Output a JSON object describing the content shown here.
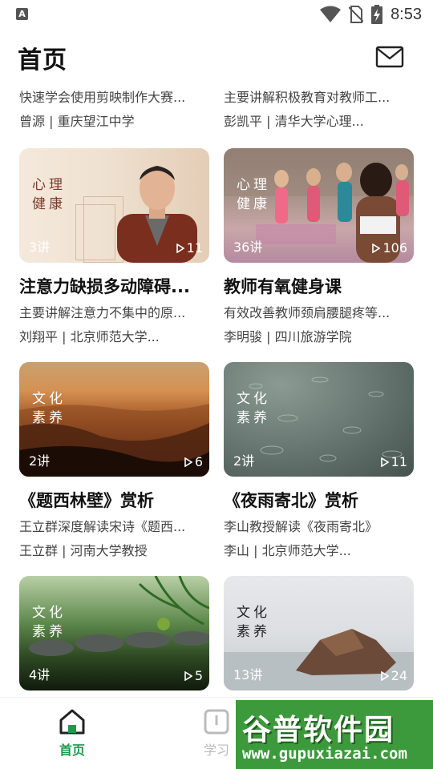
{
  "status_bar": {
    "time": "8:53",
    "left_icon": "app-a-icon",
    "icons": [
      "wifi-icon",
      "no-sim-icon",
      "battery-charging-icon"
    ]
  },
  "header": {
    "title": "首页",
    "mail_icon": "mail-icon"
  },
  "courses": [
    {
      "title": "",
      "desc": "快速学会使用剪映制作大赛...",
      "author": "曾源 | 重庆望江中学",
      "partial": true
    },
    {
      "title": "",
      "desc": "主要讲解积极教育对教师工...",
      "author": "彭凯平 | 清华大学心理...",
      "partial": true
    },
    {
      "title": "注意力缺损多动障碍...",
      "desc": "主要讲解注意力不集中的原...",
      "author": "刘翔平 | 北京师范大学...",
      "lessons": "3讲",
      "plays": "11",
      "tag": [
        "心理",
        "健康"
      ],
      "thumb": "t1"
    },
    {
      "title": "教师有氧健身课",
      "desc": "有效改善教师颈肩腰腿疼等...",
      "author": "李明骏 | 四川旅游学院",
      "lessons": "36讲",
      "plays": "106",
      "tag": [
        "心理",
        "健康"
      ],
      "thumb": "t2"
    },
    {
      "title": "《题西林壁》赏析",
      "desc": "王立群深度解读宋诗《题西...",
      "author": "王立群 | 河南大学教授",
      "lessons": "2讲",
      "plays": "6",
      "tag": [
        "文化",
        "素养"
      ],
      "thumb": "t3"
    },
    {
      "title": "《夜雨寄北》赏析",
      "desc": "李山教授解读《夜雨寄北》",
      "author": "李山 | 北京师范大学...",
      "lessons": "2讲",
      "plays": "11",
      "tag": [
        "文化",
        "素养"
      ],
      "thumb": "t4"
    },
    {
      "title": "",
      "desc": "",
      "author": "",
      "lessons": "4讲",
      "plays": "5",
      "tag": [
        "文化",
        "素养"
      ],
      "thumb": "t5"
    },
    {
      "title": "",
      "desc": "",
      "author": "",
      "lessons": "13讲",
      "plays": "24",
      "tag": [
        "文化",
        "素养"
      ],
      "thumb": "t6"
    }
  ],
  "bottom_nav": {
    "items": [
      {
        "label": "首页",
        "icon": "home-icon",
        "active": true
      },
      {
        "label": "学习",
        "icon": "study-icon",
        "active": false
      }
    ]
  },
  "watermark": {
    "logo": "谷普软件园",
    "url": "www.gupuxiazai.com"
  },
  "colors": {
    "accent": "#1a9a4a",
    "watermark_bg": "#3c9a3c"
  }
}
